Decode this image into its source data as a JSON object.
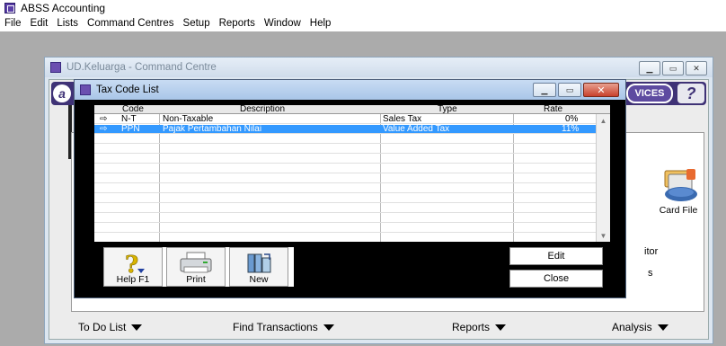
{
  "app": {
    "title": "ABSS Accounting"
  },
  "menubar": {
    "items": [
      "File",
      "Edit",
      "Lists",
      "Command Centres",
      "Setup",
      "Reports",
      "Window",
      "Help"
    ]
  },
  "command_centre": {
    "title": "UD.Keluarga - Command Centre",
    "services_label": "VICES",
    "help_label": "?",
    "card_file_label": "Card File",
    "partial_text_1": "itor",
    "partial_text_2": "s",
    "bottom": {
      "todo": "To Do List",
      "find": "Find Transactions",
      "reports": "Reports",
      "analysis": "Analysis"
    }
  },
  "dialog": {
    "title": "Tax Code List",
    "columns": {
      "code": "Code",
      "description": "Description",
      "type": "Type",
      "rate": "Rate"
    },
    "rows": [
      {
        "code": "N-T",
        "description": "Non-Taxable",
        "type": "Sales Tax",
        "rate": "0%"
      },
      {
        "code": "PPN",
        "description": "Pajak Pertambahan Nilai",
        "type": "Value Added Tax",
        "rate": "11%"
      }
    ],
    "selected_row": 1,
    "toolbar": {
      "help": "Help F1",
      "print": "Print",
      "new": "New"
    },
    "buttons": {
      "edit": "Edit",
      "close": "Close"
    }
  },
  "colors": {
    "selected_row": "#3399ff",
    "banner": "#3f3276",
    "dialog_bg": "#000000"
  }
}
